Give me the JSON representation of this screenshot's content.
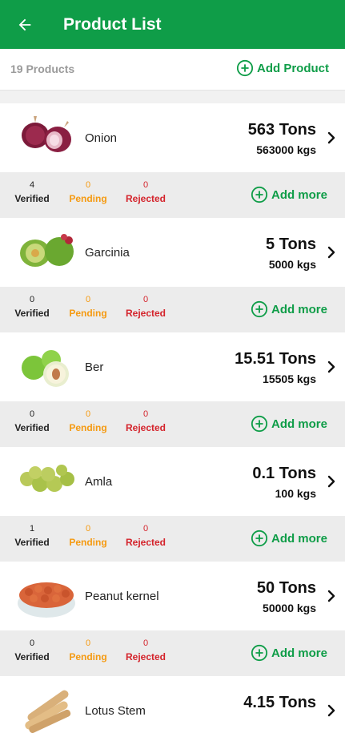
{
  "header": {
    "title": "Product List",
    "back_icon": "arrow-left-icon"
  },
  "subheader": {
    "count_text": "19 Products",
    "add_product_label": "Add Product",
    "add_icon": "plus-circle-icon"
  },
  "colors": {
    "brand": "#0f9d48",
    "pending": "#f59a11",
    "rejected": "#d4232b"
  },
  "stat_labels": {
    "verified": "Verified",
    "pending": "Pending",
    "rejected": "Rejected"
  },
  "add_more_label": "Add more",
  "products": [
    {
      "name": "Onion",
      "tons": "563 Tons",
      "kgs": "563000 kgs",
      "verified": "4",
      "pending": "0",
      "rejected": "0",
      "image": "onion"
    },
    {
      "name": "Garcinia",
      "tons": "5 Tons",
      "kgs": "5000 kgs",
      "verified": "0",
      "pending": "0",
      "rejected": "0",
      "image": "garcinia"
    },
    {
      "name": "Ber",
      "tons": "15.51 Tons",
      "kgs": "15505 kgs",
      "verified": "0",
      "pending": "0",
      "rejected": "0",
      "image": "ber"
    },
    {
      "name": "Amla",
      "tons": "0.1 Tons",
      "kgs": "100 kgs",
      "verified": "1",
      "pending": "0",
      "rejected": "0",
      "image": "amla"
    },
    {
      "name": "Peanut kernel",
      "tons": "50 Tons",
      "kgs": "50000 kgs",
      "verified": "0",
      "pending": "0",
      "rejected": "0",
      "image": "peanut"
    },
    {
      "name": "Lotus Stem",
      "tons": "4.15 Tons",
      "kgs": "",
      "verified": "",
      "pending": "",
      "rejected": "",
      "image": "lotus-stem"
    }
  ]
}
